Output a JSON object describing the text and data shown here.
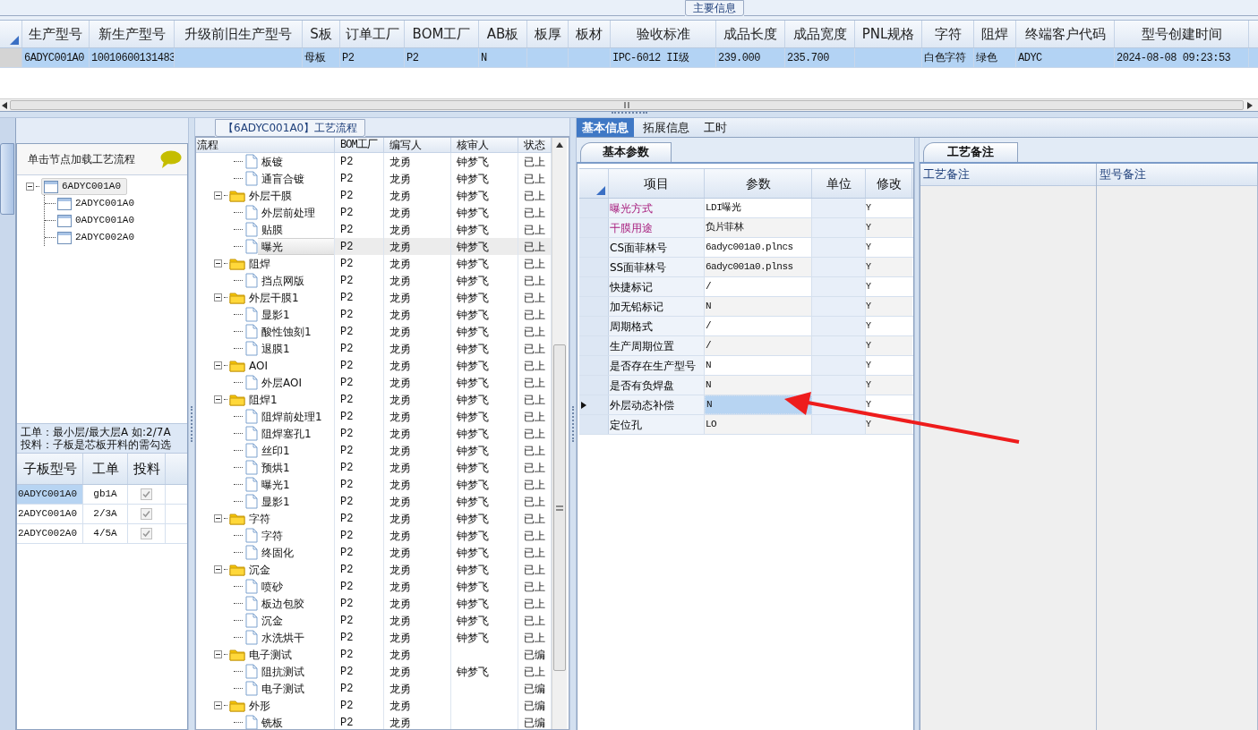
{
  "main_info": {
    "title": "主要信息",
    "columns": [
      "生产型号",
      "新生产型号",
      "升级前旧生产型号",
      "S板",
      "订单工厂",
      "BOM工厂",
      "AB板",
      "板厚",
      "板材",
      "验收标准",
      "成品长度",
      "成品宽度",
      "PNL规格",
      "字符",
      "阻焊",
      "终端客户代码",
      "型号创建时间"
    ],
    "rows": [
      {
        "selected": true,
        "cells": [
          "6ADYC001A0",
          "10010600131483",
          null,
          "母板",
          "P2",
          "P2",
          "N",
          null,
          null,
          "IPC-6012 II级",
          "239.000",
          "235.700",
          null,
          "白色字符",
          "绿色",
          "ADYC",
          "2024-08-08 09:23:53"
        ]
      }
    ]
  },
  "board_tree": {
    "hint": "单击节点加载工艺流程",
    "nodes": [
      {
        "label": "6ADYC001A0",
        "expanded": true,
        "selected": true,
        "children": [
          {
            "label": "2ADYC001A0",
            "selected": false
          },
          {
            "label": "0ADYC001A0",
            "selected": false
          },
          {
            "label": "2ADYC002A0",
            "selected": false
          }
        ]
      }
    ]
  },
  "sub_boards": {
    "note_lines": [
      "工单：最小层/最大层A 如:2/7A",
      "投料：子板是芯板开料的需勾选"
    ],
    "columns": [
      "子板型号",
      "工单",
      "投料"
    ],
    "rows": [
      {
        "model": "0ADYC001A0",
        "order": "gb1A",
        "feed": true,
        "disabled": true,
        "selected": true
      },
      {
        "model": "2ADYC001A0",
        "order": "2/3A",
        "feed": true,
        "disabled": true,
        "selected": false
      },
      {
        "model": "2ADYC002A0",
        "order": "4/5A",
        "feed": true,
        "disabled": true,
        "selected": false
      }
    ]
  },
  "flow_panel": {
    "title": "【6ADYC001A0】工艺流程",
    "columns": [
      "流程",
      "BOM工厂",
      "编写人",
      "核审人",
      "状态"
    ],
    "tree": [
      {
        "kind": "offscreen_parent",
        "children": [
          {
            "kind": "step",
            "label": "板镀",
            "bom_factory": "P2",
            "writer": "龙勇",
            "reviewer": "钟梦飞",
            "status": "已上",
            "selected": false
          },
          {
            "kind": "step",
            "label": "通盲合镀",
            "bom_factory": "P2",
            "writer": "龙勇",
            "reviewer": "钟梦飞",
            "status": "已上",
            "selected": false
          }
        ]
      },
      {
        "kind": "folder",
        "label": "外层干膜",
        "bom_factory": "P2",
        "writer": "龙勇",
        "reviewer": "钟梦飞",
        "status": "已上",
        "expanded": true,
        "selected": false,
        "children": [
          {
            "kind": "step",
            "label": "外层前处理",
            "bom_factory": "P2",
            "writer": "龙勇",
            "reviewer": "钟梦飞",
            "status": "已上",
            "selected": false
          },
          {
            "kind": "step",
            "label": "贴膜",
            "bom_factory": "P2",
            "writer": "龙勇",
            "reviewer": "钟梦飞",
            "status": "已上",
            "selected": false
          },
          {
            "kind": "step",
            "label": "曝光",
            "bom_factory": "P2",
            "writer": "龙勇",
            "reviewer": "钟梦飞",
            "status": "已上",
            "selected": true
          }
        ]
      },
      {
        "kind": "folder",
        "label": "阻焊",
        "bom_factory": "P2",
        "writer": "龙勇",
        "reviewer": "钟梦飞",
        "status": "已上",
        "expanded": true,
        "selected": false,
        "children": [
          {
            "kind": "step",
            "label": "挡点网版",
            "bom_factory": "P2",
            "writer": "龙勇",
            "reviewer": "钟梦飞",
            "status": "已上",
            "selected": false
          }
        ]
      },
      {
        "kind": "folder",
        "label": "外层干膜1",
        "bom_factory": "P2",
        "writer": "龙勇",
        "reviewer": "钟梦飞",
        "status": "已上",
        "expanded": true,
        "selected": false,
        "children": [
          {
            "kind": "step",
            "label": "显影1",
            "bom_factory": "P2",
            "writer": "龙勇",
            "reviewer": "钟梦飞",
            "status": "已上",
            "selected": false
          },
          {
            "kind": "step",
            "label": "酸性蚀刻1",
            "bom_factory": "P2",
            "writer": "龙勇",
            "reviewer": "钟梦飞",
            "status": "已上",
            "selected": false
          },
          {
            "kind": "step",
            "label": "退膜1",
            "bom_factory": "P2",
            "writer": "龙勇",
            "reviewer": "钟梦飞",
            "status": "已上",
            "selected": false
          }
        ]
      },
      {
        "kind": "folder",
        "label": "AOI",
        "bom_factory": "P2",
        "writer": "龙勇",
        "reviewer": "钟梦飞",
        "status": "已上",
        "expanded": true,
        "selected": false,
        "children": [
          {
            "kind": "step",
            "label": "外层AOI",
            "bom_factory": "P2",
            "writer": "龙勇",
            "reviewer": "钟梦飞",
            "status": "已上",
            "selected": false
          }
        ]
      },
      {
        "kind": "folder",
        "label": "阻焊1",
        "bom_factory": "P2",
        "writer": "龙勇",
        "reviewer": "钟梦飞",
        "status": "已上",
        "expanded": true,
        "selected": false,
        "children": [
          {
            "kind": "step",
            "label": "阻焊前处理1",
            "bom_factory": "P2",
            "writer": "龙勇",
            "reviewer": "钟梦飞",
            "status": "已上",
            "selected": false
          },
          {
            "kind": "step",
            "label": "阻焊塞孔1",
            "bom_factory": "P2",
            "writer": "龙勇",
            "reviewer": "钟梦飞",
            "status": "已上",
            "selected": false
          },
          {
            "kind": "step",
            "label": "丝印1",
            "bom_factory": "P2",
            "writer": "龙勇",
            "reviewer": "钟梦飞",
            "status": "已上",
            "selected": false
          },
          {
            "kind": "step",
            "label": "预烘1",
            "bom_factory": "P2",
            "writer": "龙勇",
            "reviewer": "钟梦飞",
            "status": "已上",
            "selected": false
          },
          {
            "kind": "step",
            "label": "曝光1",
            "bom_factory": "P2",
            "writer": "龙勇",
            "reviewer": "钟梦飞",
            "status": "已上",
            "selected": false
          },
          {
            "kind": "step",
            "label": "显影1",
            "bom_factory": "P2",
            "writer": "龙勇",
            "reviewer": "钟梦飞",
            "status": "已上",
            "selected": false
          }
        ]
      },
      {
        "kind": "folder",
        "label": "字符",
        "bom_factory": "P2",
        "writer": "龙勇",
        "reviewer": "钟梦飞",
        "status": "已上",
        "expanded": true,
        "selected": false,
        "children": [
          {
            "kind": "step",
            "label": "字符",
            "bom_factory": "P2",
            "writer": "龙勇",
            "reviewer": "钟梦飞",
            "status": "已上",
            "selected": false
          },
          {
            "kind": "step",
            "label": "终固化",
            "bom_factory": "P2",
            "writer": "龙勇",
            "reviewer": "钟梦飞",
            "status": "已上",
            "selected": false
          }
        ]
      },
      {
        "kind": "folder",
        "label": "沉金",
        "bom_factory": "P2",
        "writer": "龙勇",
        "reviewer": "钟梦飞",
        "status": "已上",
        "expanded": true,
        "selected": false,
        "children": [
          {
            "kind": "step",
            "label": "喷砂",
            "bom_factory": "P2",
            "writer": "龙勇",
            "reviewer": "钟梦飞",
            "status": "已上",
            "selected": false
          },
          {
            "kind": "step",
            "label": "板边包胶",
            "bom_factory": "P2",
            "writer": "龙勇",
            "reviewer": "钟梦飞",
            "status": "已上",
            "selected": false
          },
          {
            "kind": "step",
            "label": "沉金",
            "bom_factory": "P2",
            "writer": "龙勇",
            "reviewer": "钟梦飞",
            "status": "已上",
            "selected": false
          },
          {
            "kind": "step",
            "label": "水洗烘干",
            "bom_factory": "P2",
            "writer": "龙勇",
            "reviewer": "钟梦飞",
            "status": "已上",
            "selected": false
          }
        ]
      },
      {
        "kind": "folder",
        "label": "电子测试",
        "bom_factory": "P2",
        "writer": "龙勇",
        "status": "已编",
        "expanded": true,
        "selected": false,
        "children": [
          {
            "kind": "step",
            "label": "阻抗测试",
            "bom_factory": "P2",
            "writer": "龙勇",
            "reviewer": "钟梦飞",
            "status": "已上",
            "selected": false
          },
          {
            "kind": "step",
            "label": "电子测试",
            "bom_factory": "P2",
            "writer": "龙勇",
            "status": "已编",
            "selected": false
          }
        ]
      },
      {
        "kind": "folder",
        "label": "外形",
        "bom_factory": "P2",
        "writer": "龙勇",
        "status": "已编",
        "expanded": true,
        "selected": false,
        "children": [
          {
            "kind": "step",
            "label": "铣板",
            "bom_factory": "P2",
            "writer": "龙勇",
            "status": "已编",
            "selected": false
          }
        ]
      }
    ]
  },
  "detail_tabs": [
    {
      "label": "基本信息",
      "selected": true
    },
    {
      "label": "拓展信息",
      "selected": false
    },
    {
      "label": "工时",
      "selected": false
    }
  ],
  "params": {
    "tab": "基本参数",
    "columns": [
      "项目",
      "参数",
      "单位",
      "修改"
    ],
    "rows": [
      {
        "item": "曝光方式",
        "value": "LDI曝光",
        "modify": "Y",
        "highlight": true,
        "current": false,
        "selected": false
      },
      {
        "item": "干膜用途",
        "value": "负片菲林",
        "modify": "Y",
        "highlight": true,
        "current": false,
        "selected": false
      },
      {
        "item": "CS面菲林号",
        "value": "6adyc001a0.plncs",
        "modify": "Y",
        "highlight": false,
        "current": false,
        "selected": false
      },
      {
        "item": "SS面菲林号",
        "value": "6adyc001a0.plnss",
        "modify": "Y",
        "highlight": false,
        "current": false,
        "selected": false
      },
      {
        "item": "快捷标记",
        "value": "/",
        "modify": "Y",
        "highlight": false,
        "current": false,
        "selected": false
      },
      {
        "item": "加无铅标记",
        "value": "N",
        "modify": "Y",
        "highlight": false,
        "current": false,
        "selected": false
      },
      {
        "item": "周期格式",
        "value": "/",
        "modify": "Y",
        "highlight": false,
        "current": false,
        "selected": false
      },
      {
        "item": "生产周期位置",
        "value": "/",
        "modify": "Y",
        "highlight": false,
        "current": false,
        "selected": false
      },
      {
        "item": "是否存在生产型号",
        "value": "N",
        "modify": "Y",
        "highlight": false,
        "current": false,
        "selected": false
      },
      {
        "item": "是否有负焊盘",
        "value": "N",
        "modify": "Y",
        "highlight": false,
        "current": false,
        "selected": false
      },
      {
        "item": "外层动态补偿",
        "value": "N",
        "modify": "Y",
        "highlight": false,
        "current": true,
        "selected": true
      },
      {
        "item": "定位孔",
        "value": "LO",
        "modify": "Y",
        "highlight": false,
        "current": false,
        "selected": false
      }
    ]
  },
  "notes": {
    "tab": "工艺备注",
    "columns": [
      "工艺备注",
      "型号备注"
    ]
  }
}
